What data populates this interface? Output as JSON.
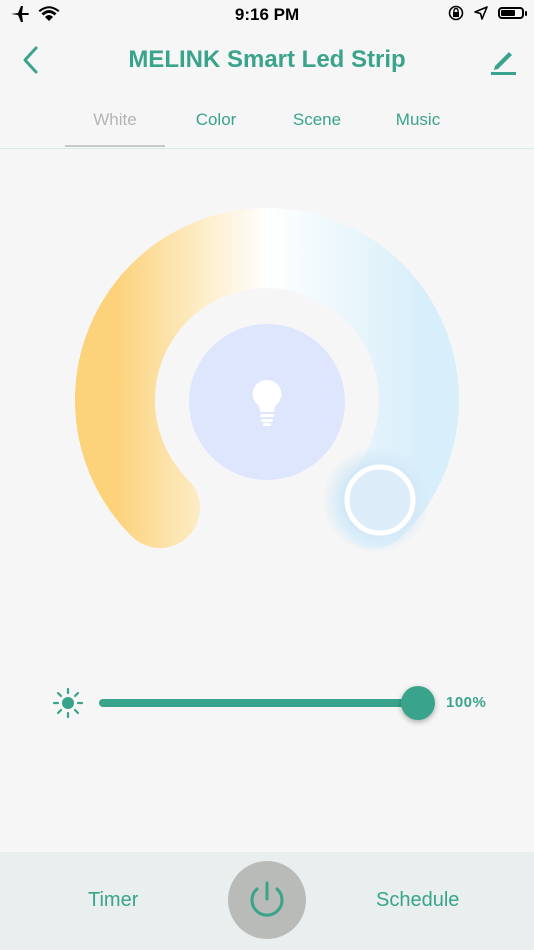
{
  "status": {
    "time": "9:16 PM",
    "icons": [
      "airplane-icon",
      "wifi-icon",
      "orientation-lock-icon",
      "location-arrow-icon",
      "battery-icon"
    ],
    "battery_level": 0.7
  },
  "header": {
    "title": "MELINK Smart Led Strip",
    "back_icon": "chevron-left-icon",
    "edit_icon": "pencil-icon"
  },
  "tabs": [
    {
      "label": "White",
      "active": true
    },
    {
      "label": "Color",
      "active": false
    },
    {
      "label": "Scene",
      "active": false
    },
    {
      "label": "Music",
      "active": false
    }
  ],
  "white_wheel": {
    "center_icon": "lightbulb-icon",
    "warm_color": "#fcd27a",
    "neutral_color": "#ffffff",
    "cool_color": "#dcf1fb",
    "center_color": "#dde6fd"
  },
  "brightness": {
    "icon": "sun-icon",
    "value_label": "100%",
    "value": 1.0
  },
  "bottom": {
    "timer_label": "Timer",
    "schedule_label": "Schedule",
    "power_icon": "power-icon"
  },
  "colors": {
    "accent": "#3aa38b",
    "background": "#f6f6f6",
    "bottom_bar": "#e9efee",
    "power_button": "#b9bbb8"
  }
}
